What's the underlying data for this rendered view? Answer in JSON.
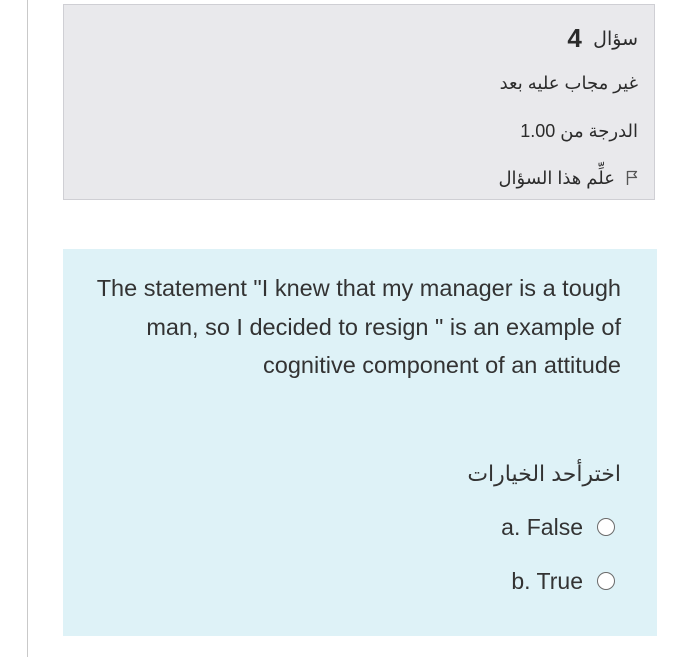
{
  "question_info": {
    "label": "سؤال",
    "number": "4",
    "status": "غير مجاب عليه بعد",
    "grade": "الدرجة من 1.00",
    "flag_label": "علِّم هذا السؤال",
    "flag_icon": "flag-outline-icon"
  },
  "question": {
    "text": "The statement \"I knew that my manager is a tough man, so I decided to resign \" is an example of cognitive component of an attitude",
    "choose_prompt": "اخترأحد الخيارات",
    "options": [
      {
        "label": "a. False",
        "selected": false
      },
      {
        "label": "b. True",
        "selected": false
      }
    ]
  },
  "colors": {
    "info_background": "#e9e9ec",
    "question_background": "#def2f7"
  }
}
